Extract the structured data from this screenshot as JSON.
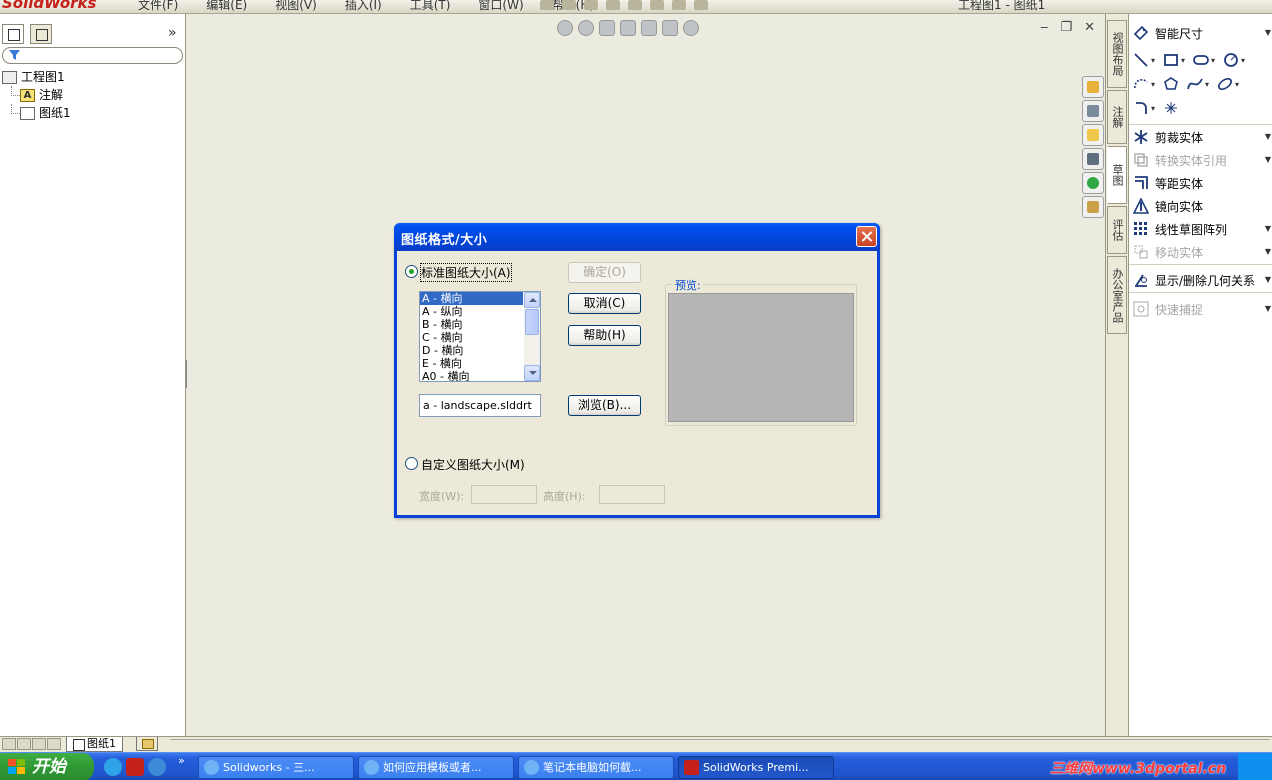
{
  "app": {
    "logo": "SolidWorks",
    "menu": [
      "文件(F)",
      "编辑(E)",
      "视图(V)",
      "插入(I)",
      "工具(T)",
      "窗口(W)",
      "帮助(H)"
    ],
    "window_title": "工程图1 - 图纸1"
  },
  "feature_tree": {
    "root": "工程图1",
    "children": [
      "注解",
      "图纸1"
    ]
  },
  "command_manager": {
    "tabs": [
      "视图布局",
      "注解",
      "草图",
      "评估",
      "办公室产品"
    ],
    "active_tab": "草图",
    "items": {
      "smart_dim": "智能尺寸",
      "trim": "剪裁实体",
      "convert": "转换实体引用",
      "offset": "等距实体",
      "mirror": "镜向实体",
      "linear_pattern": "线性草图阵列",
      "move": "移动实体",
      "relations": "显示/删除几何关系",
      "quick_snap": "快速捕捉"
    }
  },
  "sheet_tabs": {
    "current": "图纸1"
  },
  "taskbar": {
    "start": "开始",
    "tasks": [
      "Solidworks - 三...",
      "如何应用模板或者...",
      "笔记本电脑如何截...",
      "SolidWorks Premi..."
    ],
    "watermark": "三维网www.3dportal.cn"
  },
  "dialog": {
    "title": "图纸格式/大小",
    "standard_label": "标准图纸大小(A)",
    "sizes": [
      "A - 横向",
      "A - 纵向",
      "B - 横向",
      "C - 横向",
      "D - 横向",
      "E - 横向",
      "A0 - 横向"
    ],
    "selected_size": "A - 横向",
    "format_file": "a - landscape.slddrt",
    "ok_label": "确定(O)",
    "cancel_label": "取消(C)",
    "help_label": "帮助(H)",
    "browse_label": "浏览(B)...",
    "preview_label": "预览:",
    "custom_label": "自定义图纸大小(M)",
    "width_label": "宽度(W):",
    "height_label": "高度(H):",
    "width_value": "",
    "height_value": ""
  }
}
